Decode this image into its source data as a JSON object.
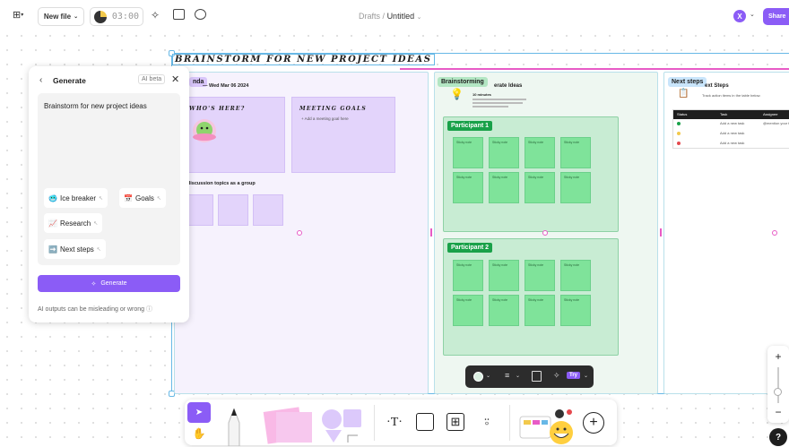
{
  "topbar": {
    "new_file_label": "New file",
    "timer": "03:00",
    "breadcrumb_parent": "Drafts",
    "breadcrumb_separator": "/",
    "breadcrumb_current": "Untitled",
    "avatar_initial": "X",
    "share_label": "Share"
  },
  "canvas": {
    "title": "BRAINSTORM FOR NEW PROJECT IDEAS",
    "agenda": {
      "tag": "nda",
      "date": "— Wed Mar 06 2024",
      "whos_here": "WHO'S HERE?",
      "meeting_goals": "MEETING GOALS",
      "add_goal": "+ Add a meeting goal here",
      "discussion": "d discussion topics as a group"
    },
    "brainstorm": {
      "tag": "Brainstorming",
      "heading": "erate Ideas",
      "minutes": "10 minutes",
      "participant1": "Participant 1",
      "participant2": "Participant 2",
      "note_text": "Sticky note"
    },
    "next": {
      "tag": "Next steps",
      "heading": "ext Steps",
      "desc": "Track action items in the table below.",
      "columns": [
        "Status",
        "Task",
        "Assignee"
      ],
      "rows": [
        {
          "task": "Add a new task",
          "assignee": "@mention your te",
          "color": "#19a149"
        },
        {
          "task": "Add a new task",
          "assignee": "",
          "color": "#f2c94c"
        },
        {
          "task": "Add a new task",
          "assignee": "",
          "color": "#e5484d"
        }
      ]
    }
  },
  "generate": {
    "title": "Generate",
    "badge": "AI beta",
    "prompt": "Brainstorm for new project ideas",
    "chips": [
      {
        "emoji": "🥶",
        "label": "Ice breaker"
      },
      {
        "emoji": "📅",
        "label": "Goals"
      },
      {
        "emoji": "📈",
        "label": "Research"
      },
      {
        "emoji": "➡️",
        "label": "Next steps"
      }
    ],
    "button": "Generate",
    "warning": "AI outputs can be misleading or wrong"
  },
  "context_toolbar": {
    "try_label": "Try"
  },
  "zoom": {
    "plus": "+",
    "minus": "−"
  },
  "help": "?"
}
